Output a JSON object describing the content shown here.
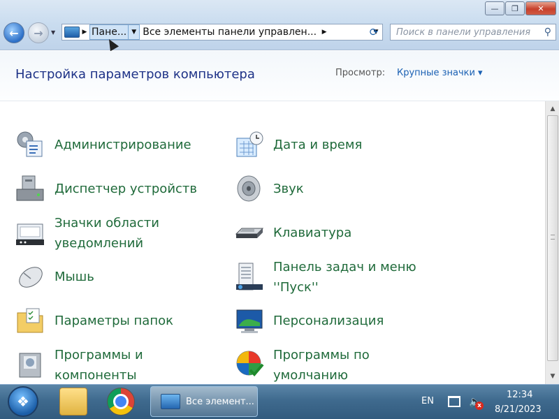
{
  "window": {
    "controls": {
      "minimize": "—",
      "maximize": "❐",
      "close": "✕"
    }
  },
  "nav": {
    "back_icon": "←",
    "forward_icon": "→",
    "recent_icon": "▼",
    "address": {
      "crumb_active": "Пане...",
      "crumb_current": "Все элементы панели управлен...",
      "separator": "▶",
      "dropdown": "▼"
    },
    "refresh_icon": "⟳",
    "search": {
      "placeholder": "Поиск в панели управления",
      "icon": "⚲"
    }
  },
  "header": {
    "title": "Настройка параметров компьютера",
    "view_label": "Просмотр:",
    "view_value": "Крупные значки ▾"
  },
  "items": [
    {
      "label": "Администрирование",
      "icon": "admin-tools-icon"
    },
    {
      "label": "Дата и время",
      "icon": "date-time-icon"
    },
    {
      "label": "Диспетчер устройств",
      "icon": "device-manager-icon"
    },
    {
      "label": "Звук",
      "icon": "sound-icon"
    },
    {
      "label": "Значки области уведомлений",
      "icon": "notification-icons-icon"
    },
    {
      "label": "Клавиатура",
      "icon": "keyboard-icon"
    },
    {
      "label": "Мышь",
      "icon": "mouse-icon"
    },
    {
      "label": "Панель задач и меню ''Пуск''",
      "icon": "taskbar-start-icon"
    },
    {
      "label": "Параметры папок",
      "icon": "folder-options-icon"
    },
    {
      "label": "Персонализация",
      "icon": "personalization-icon"
    },
    {
      "label": "Программы и компоненты",
      "icon": "programs-features-icon"
    },
    {
      "label": "Программы по умолчанию",
      "icon": "default-programs-icon"
    }
  ],
  "scrollbar": {
    "up": "▲",
    "down": "▼"
  },
  "taskbar": {
    "start_icon": "❖",
    "active_task": "Все элемент...",
    "language": "EN",
    "time": "12:34",
    "date": "8/21/2023",
    "volume_icon": "🔈",
    "mute_badge": "x"
  }
}
